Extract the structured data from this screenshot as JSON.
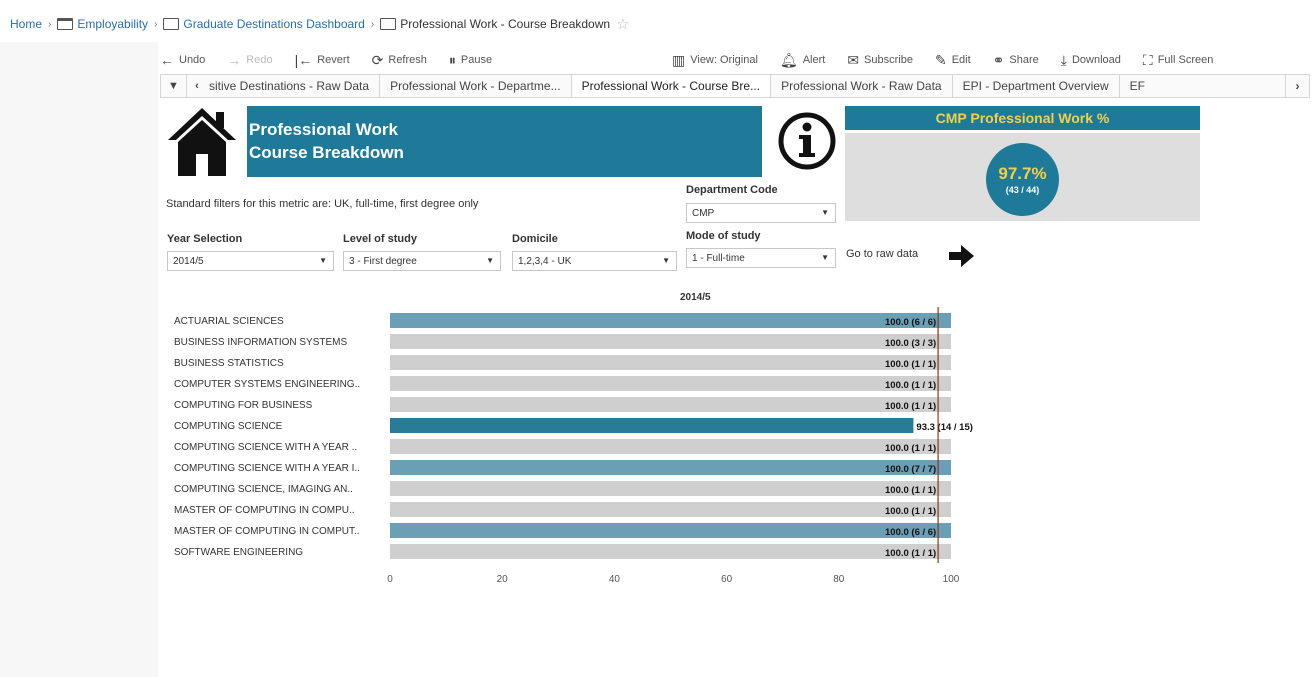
{
  "breadcrumb": {
    "home": "Home",
    "employability": "Employability",
    "dashboard": "Graduate Destinations Dashboard",
    "current": "Professional Work - Course Breakdown"
  },
  "toolbar": {
    "undo": "Undo",
    "redo": "Redo",
    "revert": "Revert",
    "refresh": "Refresh",
    "pause": "Pause",
    "view_original": "View: Original",
    "alert": "Alert",
    "subscribe": "Subscribe",
    "edit": "Edit",
    "share": "Share",
    "download": "Download",
    "full_screen": "Full Screen"
  },
  "tabs": [
    {
      "label": "sitive Destinations - Raw Data",
      "active": false
    },
    {
      "label": "Professional Work - Departme...",
      "active": false
    },
    {
      "label": "Professional Work - Course Bre...",
      "active": true
    },
    {
      "label": "Professional Work - Raw Data",
      "active": false
    },
    {
      "label": "EPI - Department Overview",
      "active": false
    },
    {
      "label": "EF",
      "active": false
    }
  ],
  "header": {
    "title_line1": "Professional Work",
    "title_line2": "Course Breakdown"
  },
  "kpi": {
    "title": "CMP Professional Work %",
    "value": "97.7%",
    "sub": "(43 / 44)"
  },
  "filters": {
    "note": "Standard filters for this metric are: UK, full-time, first degree only",
    "department_label": "Department Code",
    "department_value": "CMP",
    "year_label": "Year Selection",
    "year_value": "2014/5",
    "level_label": "Level of study",
    "level_value": "3 - First degree",
    "domicile_label": "Domicile",
    "domicile_value": "1,2,3,4 - UK",
    "mode_label": "Mode of study",
    "mode_value": "1 - Full-time",
    "raw_link": "Go to raw data"
  },
  "colors": {
    "accent": "#1f7a99",
    "kpi_text": "#f2d14a",
    "bar_highlight": "#6a9fb5",
    "bar_default": "#cfcfcf",
    "bar_strong": "#2a7b98",
    "ref_line": "#8a3a1a"
  },
  "chart_data": {
    "type": "bar",
    "orientation": "horizontal",
    "title": "2014/5",
    "xlim": [
      0,
      100
    ],
    "xticks": [
      0,
      20,
      40,
      60,
      80,
      100
    ],
    "reference_line": 97.7,
    "categories": [
      "ACTUARIAL SCIENCES",
      "BUSINESS INFORMATION SYSTEMS",
      "BUSINESS STATISTICS",
      "COMPUTER SYSTEMS ENGINEERING..",
      "COMPUTING FOR BUSINESS",
      "COMPUTING SCIENCE",
      "COMPUTING SCIENCE WITH A YEAR ..",
      "COMPUTING SCIENCE WITH A YEAR I..",
      "COMPUTING SCIENCE, IMAGING AN..",
      "MASTER OF COMPUTING IN COMPU..",
      "MASTER OF COMPUTING IN COMPUT..",
      "SOFTWARE ENGINEERING"
    ],
    "values": [
      100.0,
      100.0,
      100.0,
      100.0,
      100.0,
      93.3,
      100.0,
      100.0,
      100.0,
      100.0,
      100.0,
      100.0
    ],
    "labels": [
      "100.0 (6 / 6)",
      "100.0 (3 / 3)",
      "100.0 (1 / 1)",
      "100.0 (1 / 1)",
      "100.0 (1 / 1)",
      "93.3 (14 / 15)",
      "100.0 (1 / 1)",
      "100.0 (7 / 7)",
      "100.0 (1 / 1)",
      "100.0 (1 / 1)",
      "100.0 (6 / 6)",
      "100.0 (1 / 1)"
    ],
    "color_keys": [
      "highlight",
      "default",
      "default",
      "default",
      "default",
      "strong",
      "default",
      "highlight",
      "default",
      "default",
      "highlight",
      "default"
    ]
  }
}
